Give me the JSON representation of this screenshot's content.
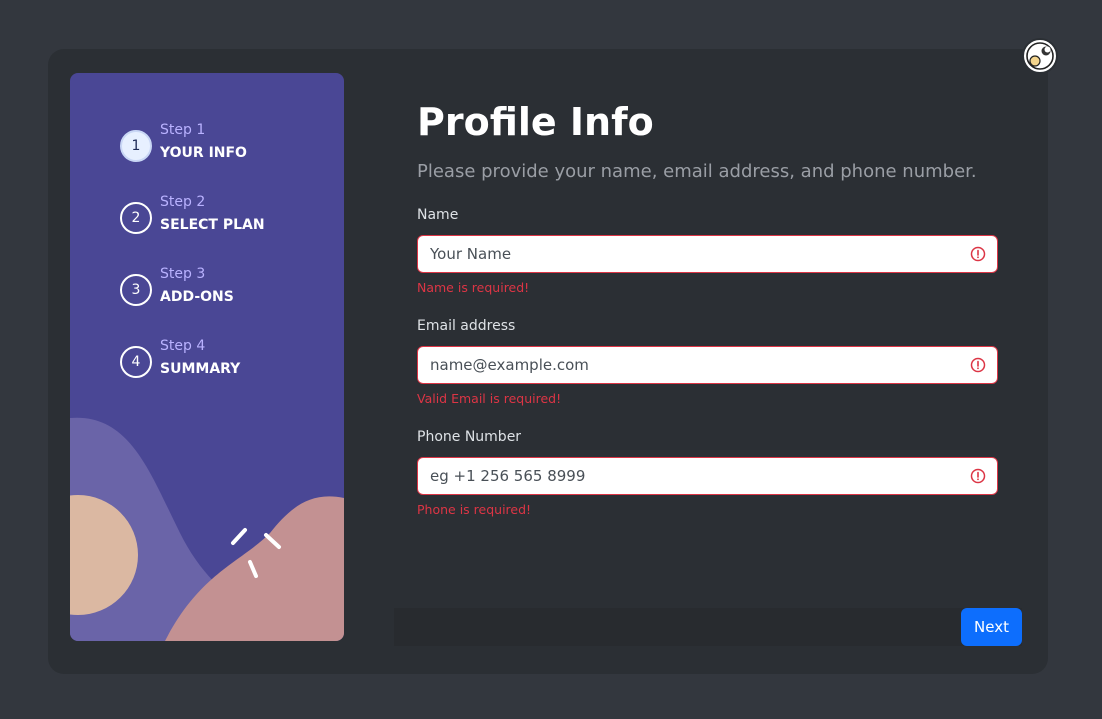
{
  "sidebar": {
    "steps": [
      {
        "number": "1",
        "sub": "Step 1",
        "title": "YOUR INFO"
      },
      {
        "number": "2",
        "sub": "Step 2",
        "title": "SELECT PLAN"
      },
      {
        "number": "3",
        "sub": "Step 3",
        "title": "ADD-ONS"
      },
      {
        "number": "4",
        "sub": "Step 4",
        "title": "SUMMARY"
      }
    ],
    "active_step": 1
  },
  "main": {
    "title": "Profile Info",
    "subtitle": "Please provide your name, email address, and phone number.",
    "fields": [
      {
        "label": "Name",
        "placeholder": "Your Name",
        "error": "Name is required!"
      },
      {
        "label": "Email address",
        "placeholder": "name@example.com",
        "error": "Valid Email is required!"
      },
      {
        "label": "Phone Number",
        "placeholder": "eg +1 256 565 8999",
        "error": "Phone is required!"
      }
    ]
  },
  "footer": {
    "next_label": "Next"
  },
  "icons": {
    "theme": "theme-toggle-icon",
    "error": "alert-circle-icon"
  },
  "colors": {
    "sidebar_bg": "#4a4795",
    "error": "#dc3545",
    "primary": "#0d6efd",
    "card_bg": "#2b2f34",
    "page_bg": "#33373e"
  }
}
